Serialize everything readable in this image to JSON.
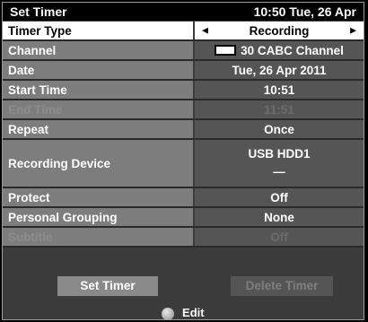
{
  "title": {
    "left": "Set Timer",
    "right": "10:50 Tue, 26 Apr"
  },
  "rows": {
    "timer_type": {
      "label": "Timer Type",
      "value": "Recording"
    },
    "channel": {
      "label": "Channel",
      "value": "30 CABC Channel"
    },
    "date": {
      "label": "Date",
      "value": "Tue, 26 Apr 2011"
    },
    "start_time": {
      "label": "Start Time",
      "value": "10:51"
    },
    "end_time": {
      "label": "End Time",
      "value": "11:51"
    },
    "repeat": {
      "label": "Repeat",
      "value": "Once"
    },
    "recording_device": {
      "label": "Recording Device",
      "value_line1": "USB HDD1",
      "value_line2": "—"
    },
    "protect": {
      "label": "Protect",
      "value": "Off"
    },
    "personal_grouping": {
      "label": "Personal Grouping",
      "value": "None"
    },
    "subtitle": {
      "label": "Subtitle",
      "value": "Off"
    }
  },
  "buttons": {
    "set_timer": "Set Timer",
    "delete_timer": "Delete Timer"
  },
  "hint": {
    "label": "Edit",
    "icon": "dpad-icon"
  },
  "icons": {
    "arrow_left": "◀",
    "arrow_right": "▶"
  },
  "colors": {
    "selected_row": "#ffffff",
    "label_bg": "#7d7d7d",
    "value_bg": "#555555",
    "title_bg": "#000000"
  }
}
